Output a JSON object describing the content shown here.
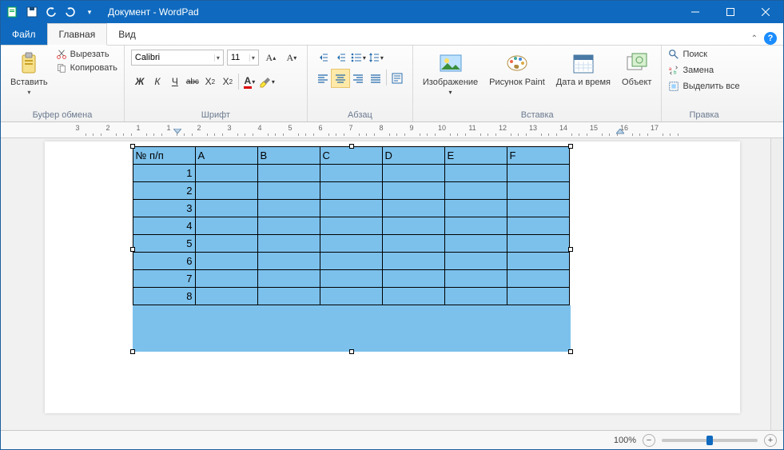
{
  "window": {
    "title": "Документ - WordPad"
  },
  "tabs": {
    "file": "Файл",
    "home": "Главная",
    "view": "Вид"
  },
  "ribbon": {
    "clipboard": {
      "paste": "Вставить",
      "cut": "Вырезать",
      "copy": "Копировать",
      "group": "Буфер обмена"
    },
    "font": {
      "family": "Calibri",
      "size": "11",
      "group": "Шрифт"
    },
    "paragraph": {
      "group": "Абзац"
    },
    "insert": {
      "image": "Изображение",
      "paint": "Рисунок Paint",
      "datetime": "Дата и время",
      "object": "Объект",
      "group": "Вставка"
    },
    "editing": {
      "find": "Поиск",
      "replace": "Замена",
      "selectall": "Выделить все",
      "group": "Правка"
    }
  },
  "ruler": {
    "marks": [
      "3",
      "2",
      "1",
      "1",
      "2",
      "3",
      "4",
      "5",
      "6",
      "7",
      "8",
      "9",
      "10",
      "11",
      "12",
      "13",
      "14",
      "15",
      "16",
      "17"
    ]
  },
  "table": {
    "headers": [
      "№ п/п",
      "A",
      "B",
      "C",
      "D",
      "E",
      "F"
    ],
    "rows": [
      "1",
      "2",
      "3",
      "4",
      "5",
      "6",
      "7",
      "8"
    ]
  },
  "status": {
    "zoom": "100%"
  }
}
